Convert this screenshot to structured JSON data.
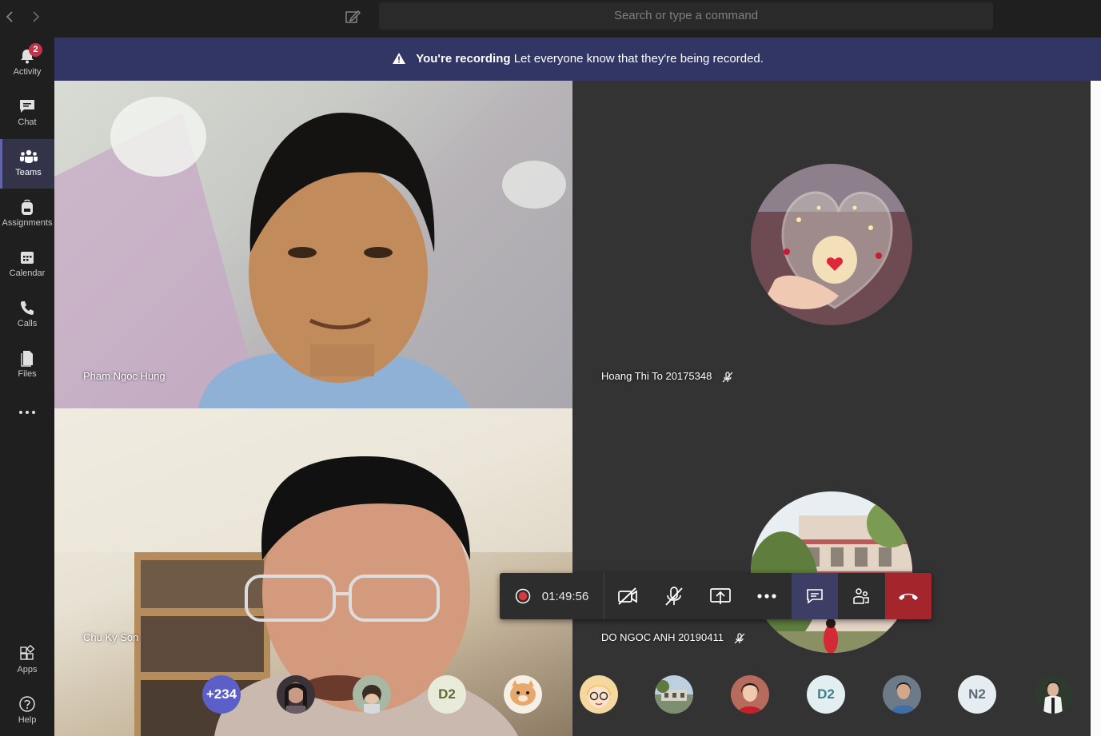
{
  "topbar": {
    "back_icon": "chevron-left-icon",
    "forward_icon": "chevron-right-icon",
    "compose_icon": "compose-icon",
    "search_placeholder": "Search or type a command"
  },
  "rail": {
    "items": [
      {
        "label": "Activity",
        "icon": "bell-icon",
        "badge": "2"
      },
      {
        "label": "Chat",
        "icon": "chat-icon"
      },
      {
        "label": "Teams",
        "icon": "teams-icon",
        "active": true
      },
      {
        "label": "Assignments",
        "icon": "backpack-icon"
      },
      {
        "label": "Calendar",
        "icon": "calendar-icon"
      },
      {
        "label": "Calls",
        "icon": "phone-icon"
      },
      {
        "label": "Files",
        "icon": "file-icon"
      }
    ],
    "more_icon": "ellipsis-icon",
    "bottom": [
      {
        "label": "Apps",
        "icon": "apps-icon"
      },
      {
        "label": "Help",
        "icon": "help-icon"
      }
    ]
  },
  "banner": {
    "icon": "warning-icon",
    "bold": "You're recording",
    "text": "Let everyone know that they're being recorded."
  },
  "tiles": [
    {
      "name": "Pham Ngoc Hung",
      "muted": false
    },
    {
      "name": "Hoang Thi To 20175348",
      "muted": true
    },
    {
      "name": "Chu Ky Son",
      "muted": false
    },
    {
      "name": "DO NGOC ANH 20190411",
      "muted": true
    }
  ],
  "controls": {
    "timer": "01:49:56",
    "record_icon": "record-icon",
    "buttons": [
      "video-off-icon",
      "mic-off-icon",
      "share-screen-icon",
      "more-icon",
      "chat-icon",
      "participants-icon",
      "hang-up-icon"
    ]
  },
  "participants": {
    "overflow": "+234",
    "initials": [
      "D2",
      "D2",
      "N2"
    ]
  },
  "colors": {
    "banner": "#313665",
    "accent": "#6264a7",
    "hangup": "#a4262c",
    "badge": "#c4314b"
  }
}
